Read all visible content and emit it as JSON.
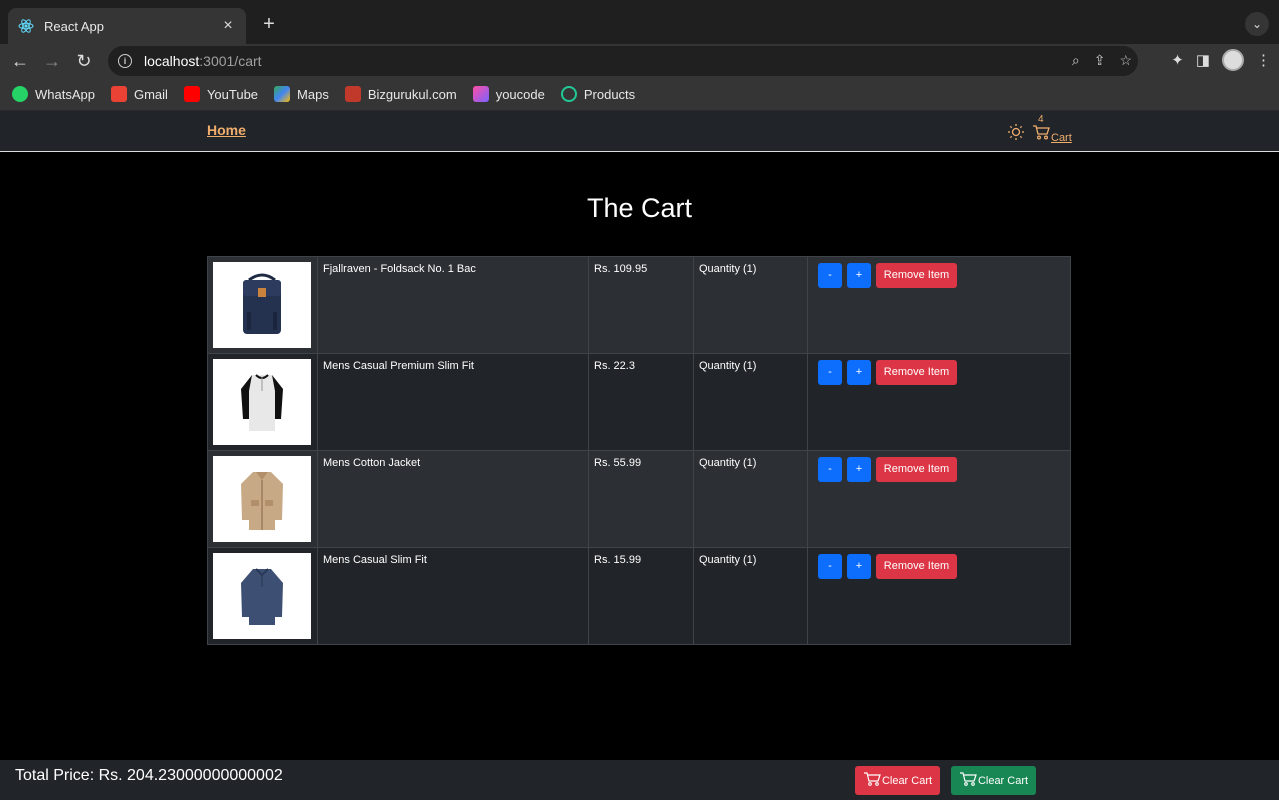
{
  "browser": {
    "tab_title": "React App",
    "tab_close": "×",
    "new_tab": "+",
    "url_host": "localhost",
    "url_rest": ":3001/cart"
  },
  "bookmarks": [
    {
      "label": "WhatsApp",
      "color": "#25d366"
    },
    {
      "label": "Gmail",
      "color": "#ea4335"
    },
    {
      "label": "YouTube",
      "color": "#ff0000"
    },
    {
      "label": "Maps",
      "color": "#34a853"
    },
    {
      "label": "Bizgurukul.com",
      "color": "#c0392b"
    },
    {
      "label": "youcode",
      "color": "#7b61ff"
    },
    {
      "label": "Products",
      "color": "#20c997"
    }
  ],
  "nav": {
    "home": "Home",
    "cart_count": "4",
    "cart_label": "Cart",
    "accent_color": "#f0ad6e"
  },
  "page_title": "The Cart",
  "items": [
    {
      "title": "Fjallraven - Foldsack No. 1 Bac",
      "price": "Rs. 109.95",
      "quantity": "Quantity (1)",
      "image": "backpack"
    },
    {
      "title": "Mens Casual Premium Slim Fit",
      "price": "Rs. 22.3",
      "quantity": "Quantity (1)",
      "image": "raglan-tshirt"
    },
    {
      "title": "Mens Cotton Jacket",
      "price": "Rs. 55.99",
      "quantity": "Quantity (1)",
      "image": "jacket"
    },
    {
      "title": "Mens Casual Slim Fit",
      "price": "Rs. 15.99",
      "quantity": "Quantity (1)",
      "image": "long-sleeve-shirt"
    }
  ],
  "buttons": {
    "minus": "-",
    "plus": "+",
    "remove": "Remove Item"
  },
  "footer": {
    "total": "Total Price: Rs. 204.23000000000002",
    "clear_cart_red": "Clear Cart",
    "clear_cart_green": "Clear Cart"
  }
}
